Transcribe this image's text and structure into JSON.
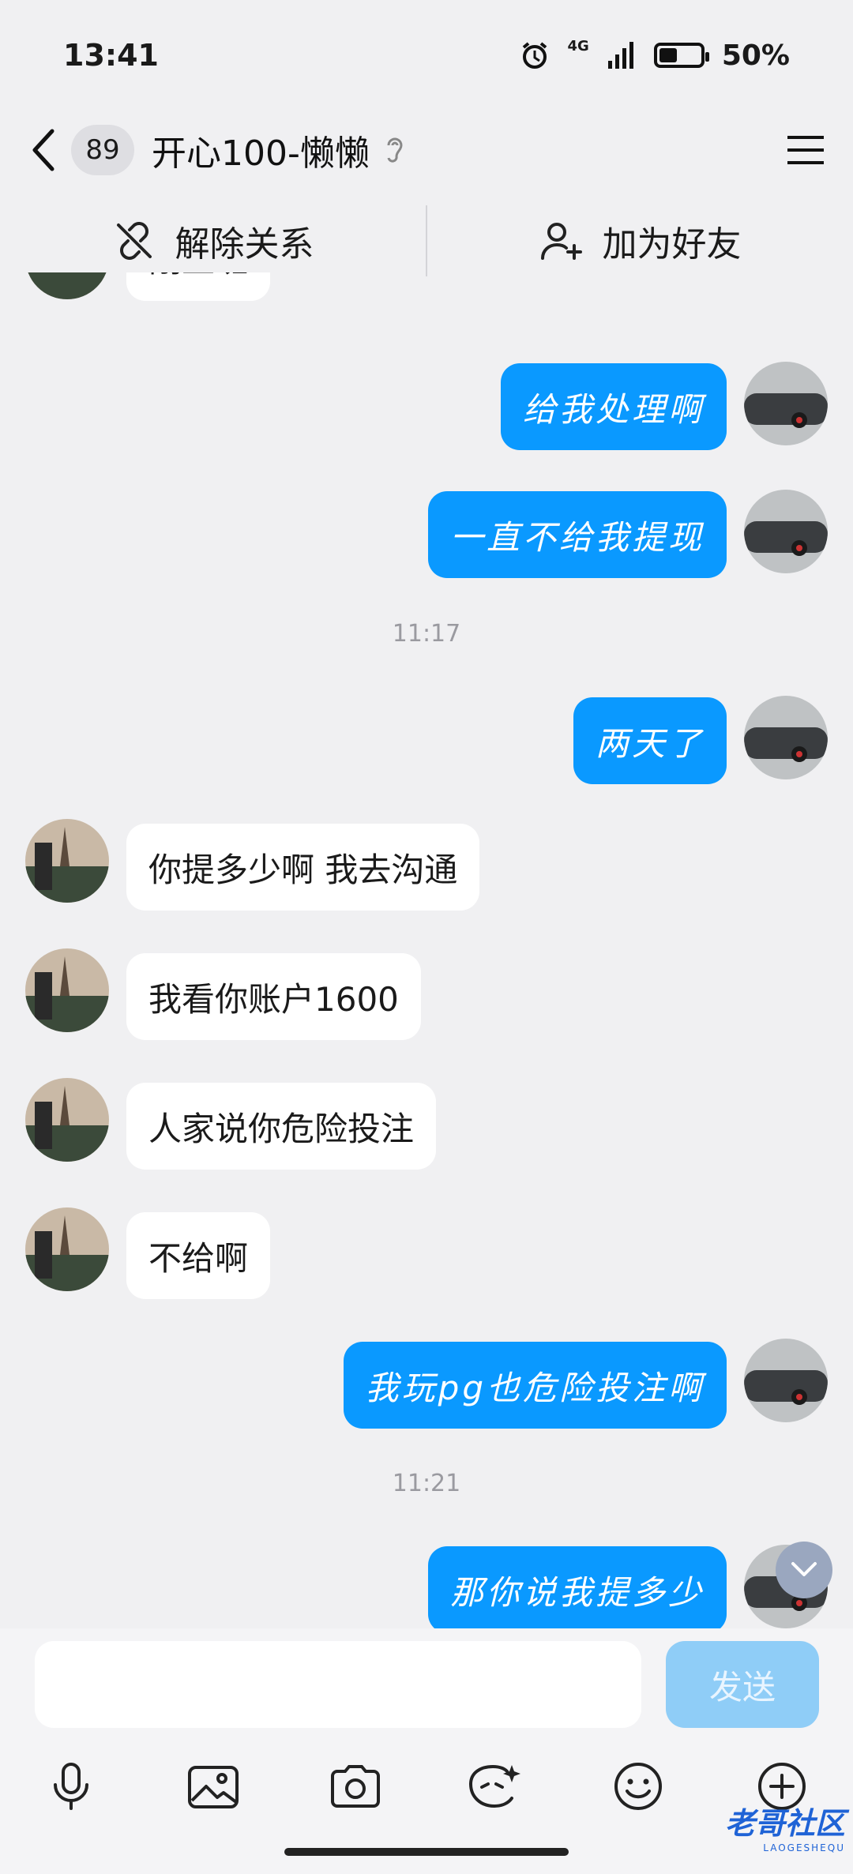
{
  "status": {
    "time": "13:41",
    "network": "4G",
    "battery": "50%"
  },
  "header": {
    "unread_count": "89",
    "title": "开心100-懒懒"
  },
  "actions": {
    "unbind_label": "解除关系",
    "add_friend_label": "加为好友"
  },
  "messages": [
    {
      "side": "in",
      "text": "刚上班"
    },
    {
      "side": "out",
      "text": "给我处理啊"
    },
    {
      "side": "out",
      "text": "一直不给我提现"
    },
    {
      "side": "time",
      "text": "11:17"
    },
    {
      "side": "out",
      "text": "两天了"
    },
    {
      "side": "in",
      "text": "你提多少啊  我去沟通"
    },
    {
      "side": "in",
      "text": "我看你账户1600"
    },
    {
      "side": "in",
      "text": "人家说你危险投注"
    },
    {
      "side": "in",
      "text": "不给啊"
    },
    {
      "side": "out",
      "text": "我玩pg也危险投注啊"
    },
    {
      "side": "time",
      "text": "11:21"
    },
    {
      "side": "out",
      "text": "那你说我提多少"
    }
  ],
  "composer": {
    "input_value": "",
    "send_label": "发送"
  },
  "toolbar": [
    "microphone-icon",
    "image-icon",
    "camera-icon",
    "sticker-icon",
    "emoji-icon",
    "plus-icon"
  ],
  "watermark": {
    "text": "老哥社区",
    "sub": "LAOGESHEQU"
  },
  "colors": {
    "outgoing_bubble": "#0a99ff",
    "incoming_bubble": "#ffffff",
    "background": "#f0f0f2"
  }
}
